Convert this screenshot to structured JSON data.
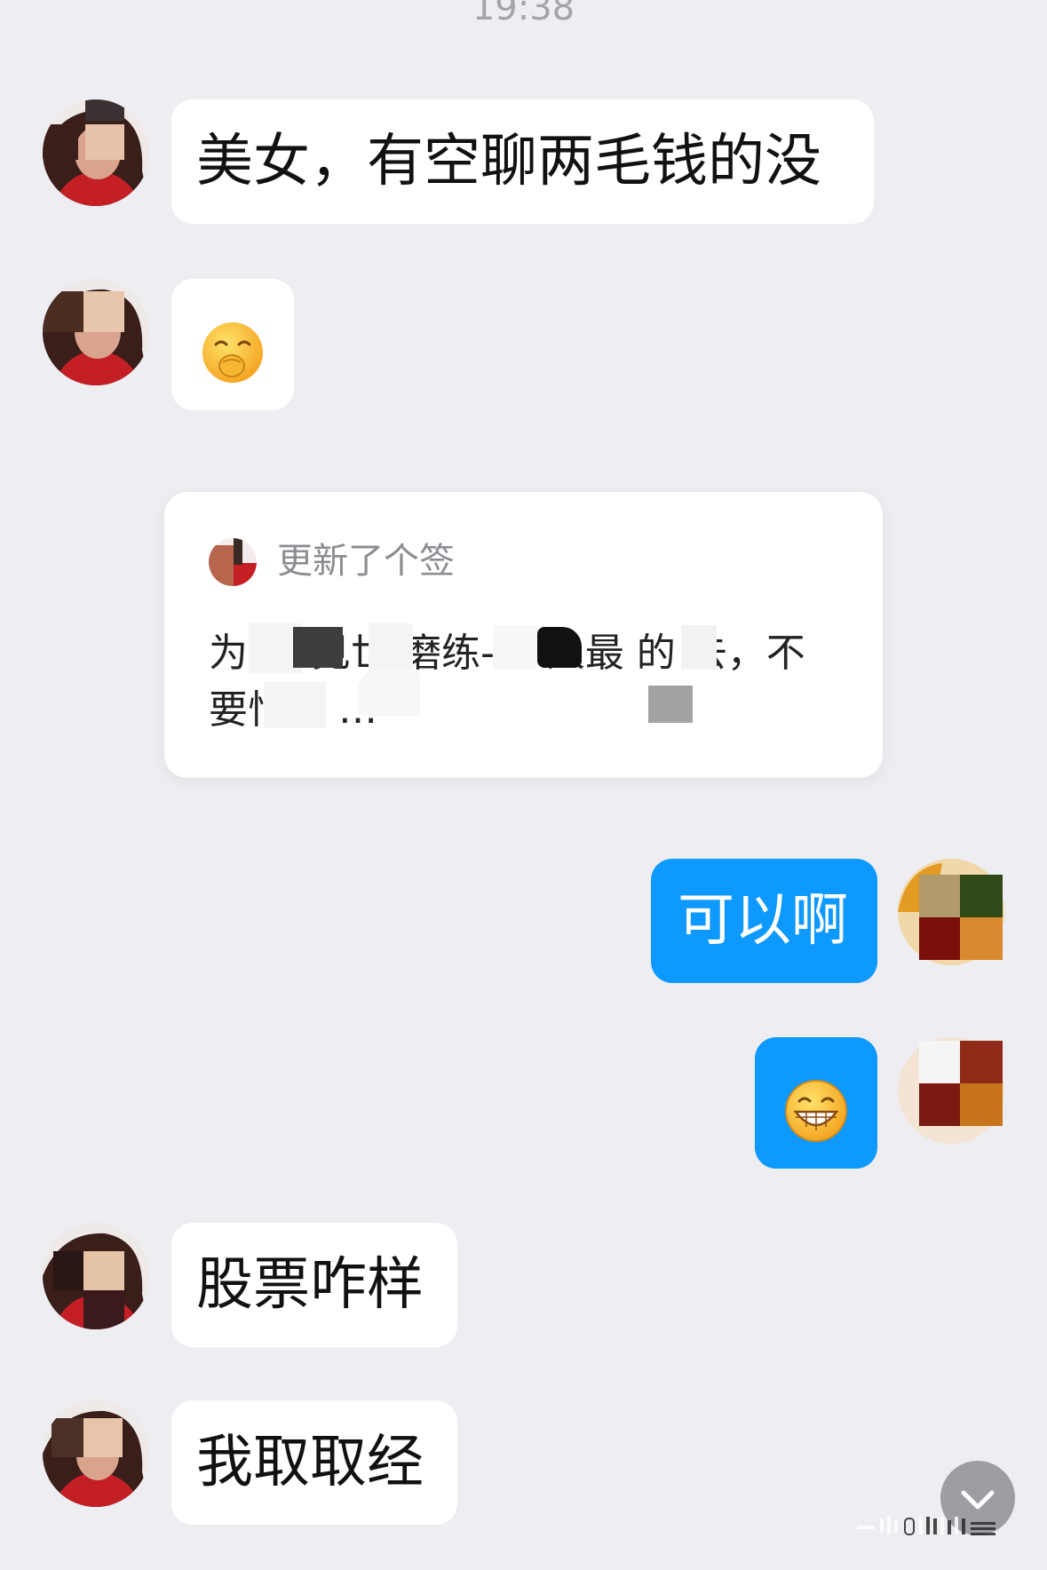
{
  "timestamp": "19:38",
  "messages": [
    {
      "side": "in",
      "text": "美女，有空聊两毛钱的没"
    },
    {
      "side": "in",
      "emoji": "covering-mouth-smile-emoji"
    },
    {
      "side": "out",
      "text": "可以啊"
    },
    {
      "side": "out",
      "emoji": "grinning-face-emoji"
    },
    {
      "side": "in",
      "text": "股票咋样"
    },
    {
      "side": "in",
      "text": "我取取经"
    }
  ],
  "status_card": {
    "title": "更新了个签",
    "body": "为 认 见世 磨练- 个人最 的 去，不要怕吃 …"
  },
  "colors": {
    "background": "#ededf2",
    "incoming_bubble": "#ffffff",
    "outgoing_bubble": "#0d99ff",
    "scroll_button": "#9d9ea3"
  },
  "icons": {
    "scroll_to_bottom": "chevron-down-icon"
  }
}
